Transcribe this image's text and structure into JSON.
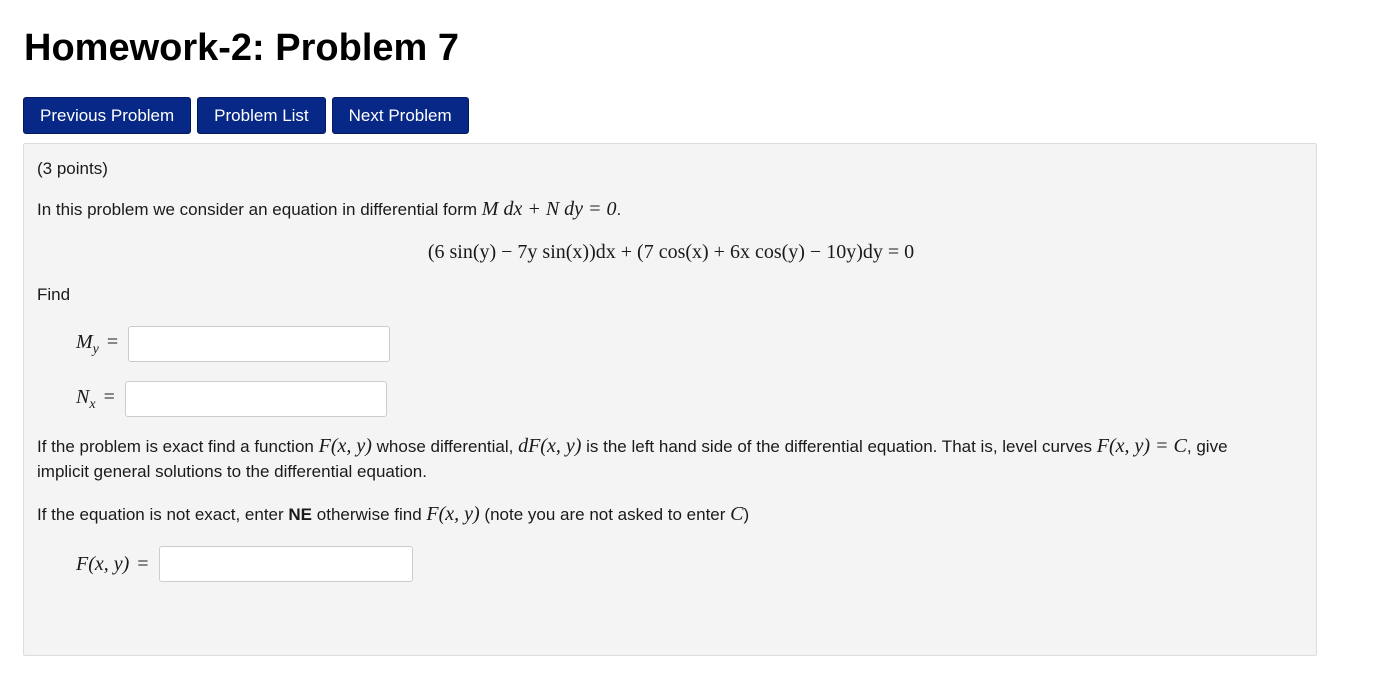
{
  "header": {
    "title": "Homework-2: Problem 7"
  },
  "nav": {
    "previous": "Previous Problem",
    "list": "Problem List",
    "next": "Next Problem"
  },
  "problem": {
    "points": "(3 points)",
    "intro_text": "In this problem we consider an equation in differential form",
    "intro_math": "M dx + N dy = 0",
    "equation": "(6 sin(y) − 7y sin(x))dx + (7 cos(x) + 6x cos(y) − 10y)dy = 0",
    "find": "Find",
    "exact_text_1": "If the problem is exact find a function",
    "exact_text_2": "whose differential,",
    "exact_text_3": "is the left hand side of the differential equation. That is, level curves",
    "exact_text_4": ", give",
    "exact_text_5": "implicit general solutions to the differential equation.",
    "ne_text_1": "If the equation is not exact, enter",
    "ne_bold": "NE",
    "ne_text_2": "otherwise find",
    "ne_text_3": "(note you are not asked to enter",
    "ne_text_4": ")",
    "m_F": "F(x, y)",
    "m_dF": "dF(x, y)",
    "m_FC": "F(x, y) = C",
    "m_C": "C",
    "answers": [
      {
        "label": "M",
        "sub": "y",
        "value": ""
      },
      {
        "label": "N",
        "sub": "x",
        "value": ""
      },
      {
        "label": "F(x, y)",
        "sub": "",
        "value": ""
      }
    ]
  }
}
